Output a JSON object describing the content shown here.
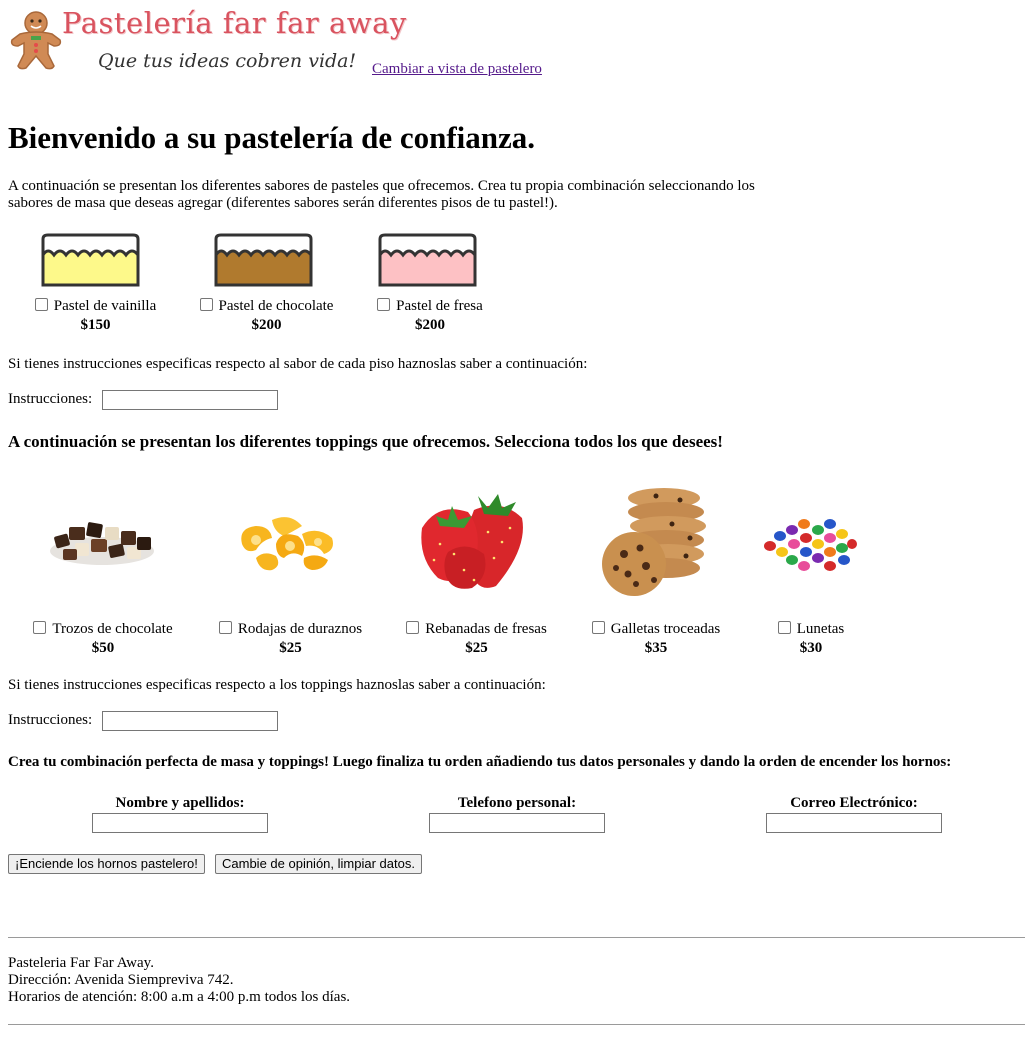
{
  "header": {
    "title": "Pastelería far far away",
    "tagline": "Que tus ideas cobren vida!",
    "logo_icon": "gingerbread-man-icon",
    "switch_link": "Cambiar a vista de pastelero"
  },
  "main": {
    "heading": "Bienvenido a su pastelería de confianza.",
    "intro": "A continuación se presentan los diferentes sabores de pasteles que ofrecemos. Crea tu propia combinación seleccionando los sabores de masa que deseas agregar (diferentes sabores serán diferentes pisos de tu pastel!).",
    "flavors": [
      {
        "label": "Pastel de vainilla",
        "price": "$150",
        "color": "#fdf98a"
      },
      {
        "label": "Pastel de chocolate",
        "price": "$200",
        "color": "#b07a2e"
      },
      {
        "label": "Pastel de fresa",
        "price": "$200",
        "color": "#fdc1c4"
      }
    ],
    "flavor_instructions_text": "Si tienes instrucciones especificas respecto al sabor de cada piso haznoslas saber a continuación:",
    "instructions_label": "Instrucciones:",
    "toppings_heading": "A continuación se presentan los diferentes toppings que ofrecemos. Selecciona todos los que desees!",
    "toppings": [
      {
        "label": "Trozos de chocolate",
        "price": "$50",
        "icon": "chocolate-pieces-icon"
      },
      {
        "label": "Rodajas de duraznos",
        "price": "$25",
        "icon": "peach-slices-icon"
      },
      {
        "label": "Rebanadas de fresas",
        "price": "$25",
        "icon": "strawberries-icon"
      },
      {
        "label": "Galletas troceadas",
        "price": "$35",
        "icon": "cookies-icon"
      },
      {
        "label": "Lunetas",
        "price": "$30",
        "icon": "candy-icon"
      }
    ],
    "toppings_instructions_text": "Si tienes instrucciones especificas respecto a los toppings haznoslas saber a continuación:",
    "final_text": "Crea tu combinación perfecta de masa y toppings! Luego finaliza tu orden añadiendo tus datos personales y dando la orden de encender los hornos:",
    "fields": {
      "name_label": "Nombre y apellidos:",
      "phone_label": "Telefono personal:",
      "email_label": "Correo Electrónico:"
    },
    "buttons": {
      "submit": "¡Enciende los hornos pastelero!",
      "reset": "Cambie de opinión, limpiar datos."
    }
  },
  "footer": {
    "name": "Pasteleria Far Far Away.",
    "address": "Dirección: Avenida Siempreviva 742.",
    "hours": "Horarios de atención: 8:00 a.m a 4:00 p.m todos los días."
  }
}
